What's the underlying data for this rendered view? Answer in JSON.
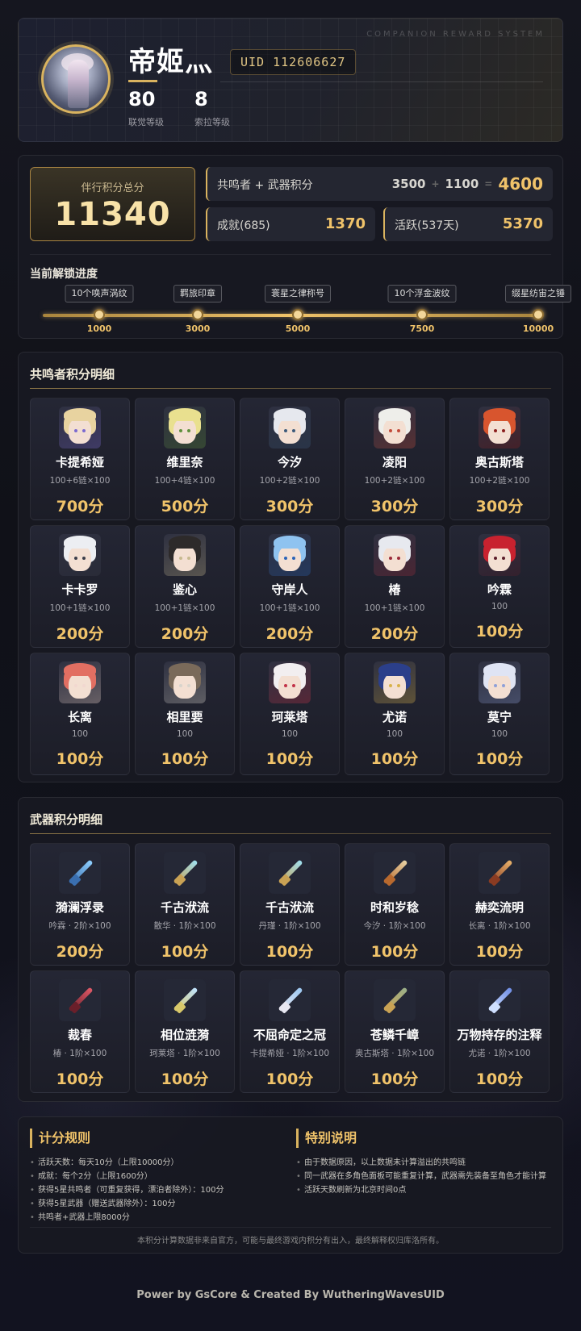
{
  "header": {
    "system_label": "COMPANION REWARD SYSTEM",
    "player_name": "帝姬灬",
    "uid": "UID 112606627",
    "stats": [
      {
        "value": "80",
        "label": "联觉等级"
      },
      {
        "value": "8",
        "label": "索拉等级"
      }
    ]
  },
  "summary": {
    "total_label": "伴行积分总分",
    "total_value": "11340",
    "resonator_weapon_label": "共鸣者 + 武器积分",
    "resonator_points": "3500",
    "plus": "+",
    "weapon_points": "1100",
    "equals": "=",
    "resonator_weapon_total": "4600",
    "achievement_label": "成就(685)",
    "achievement_points": "1370",
    "activity_label": "活跃(537天)",
    "activity_points": "5370"
  },
  "progress": {
    "title": "当前解锁进度",
    "progress_value": 10000,
    "max": 10000,
    "milestones": [
      {
        "value": "1000",
        "reward": "10个唤声涡纹"
      },
      {
        "value": "3000",
        "reward": "羁旅印章"
      },
      {
        "value": "5000",
        "reward": "寰星之律称号"
      },
      {
        "value": "7500",
        "reward": "10个浮金波纹"
      },
      {
        "value": "10000",
        "reward": "缀星纺宙之锤"
      }
    ]
  },
  "resonators": {
    "title": "共鸣者积分明细",
    "items": [
      {
        "name": "卡提希娅",
        "detail": "100+6链×100",
        "score": "700分",
        "hair": "#e8d3a0",
        "accent": "#7b6ad0"
      },
      {
        "name": "维里奈",
        "detail": "100+4链×100",
        "score": "500分",
        "hair": "#e9e08f",
        "accent": "#5e8f3b"
      },
      {
        "name": "今汐",
        "detail": "100+2链×100",
        "score": "300分",
        "hair": "#e6e8ee",
        "accent": "#3c5a7a"
      },
      {
        "name": "凌阳",
        "detail": "100+2链×100",
        "score": "300分",
        "hair": "#eeeeea",
        "accent": "#c24a3a"
      },
      {
        "name": "奥古斯塔",
        "detail": "100+2链×100",
        "score": "300分",
        "hair": "#d8552e",
        "accent": "#8b1e1e"
      },
      {
        "name": "卡卡罗",
        "detail": "100+1链×100",
        "score": "200分",
        "hair": "#eceef2",
        "accent": "#3a3d4a"
      },
      {
        "name": "鉴心",
        "detail": "100+1链×100",
        "score": "200分",
        "hair": "#2d2a2a",
        "accent": "#c7b98f"
      },
      {
        "name": "守岸人",
        "detail": "100+1链×100",
        "score": "200分",
        "hair": "#8fc3f0",
        "accent": "#2a63b7"
      },
      {
        "name": "椿",
        "detail": "100+1链×100",
        "score": "200分",
        "hair": "#e7e9ef",
        "accent": "#9b2b3a"
      },
      {
        "name": "吟霖",
        "detail": "100",
        "score": "100分",
        "hair": "#c8222f",
        "accent": "#5a1d2a"
      },
      {
        "name": "长离",
        "detail": "100",
        "score": "100分",
        "hair": "#e26f62",
        "accent": "#f2d8d0"
      },
      {
        "name": "相里要",
        "detail": "100",
        "score": "100分",
        "hair": "#7a6a5a",
        "accent": "#d8d4cc"
      },
      {
        "name": "珂莱塔",
        "detail": "100",
        "score": "100分",
        "hair": "#f2eef0",
        "accent": "#c23248"
      },
      {
        "name": "尤诺",
        "detail": "100",
        "score": "100分",
        "hair": "#2b3f8a",
        "accent": "#d8b24a"
      },
      {
        "name": "莫宁",
        "detail": "100",
        "score": "100分",
        "hair": "#dfe4f4",
        "accent": "#8ea0d8"
      }
    ]
  },
  "weapons": {
    "title": "武器积分明细",
    "items": [
      {
        "name": "漪澜浮录",
        "detail": "吟霖 · 2阶×100",
        "score": "200分",
        "blade": "#8fd0ff",
        "hilt": "#3a6fb0"
      },
      {
        "name": "千古洑流",
        "detail": "散华 · 1阶×100",
        "score": "100分",
        "blade": "#9fe0f0",
        "hilt": "#c9a254"
      },
      {
        "name": "千古洑流",
        "detail": "丹瑾 · 1阶×100",
        "score": "100分",
        "blade": "#9fe0f0",
        "hilt": "#c9a254"
      },
      {
        "name": "时和岁稔",
        "detail": "今汐 · 1阶×100",
        "score": "100分",
        "blade": "#e7d2a4",
        "hilt": "#b8692e"
      },
      {
        "name": "赫奕流明",
        "detail": "长离 · 1阶×100",
        "score": "100分",
        "blade": "#e9b36c",
        "hilt": "#8a3b22"
      },
      {
        "name": "裁春",
        "detail": "椿 · 1阶×100",
        "score": "100分",
        "blade": "#e05a68",
        "hilt": "#6a1f2a"
      },
      {
        "name": "相位涟漪",
        "detail": "珂莱塔 · 1阶×100",
        "score": "100分",
        "blade": "#bfe3ff",
        "hilt": "#d8c86a"
      },
      {
        "name": "不屈命定之冠",
        "detail": "卡提希娅 · 1阶×100",
        "score": "100分",
        "blade": "#9cc8f2",
        "hilt": "#e8e8f2"
      },
      {
        "name": "苍鳞千嶂",
        "detail": "奥古斯塔 · 1阶×100",
        "score": "100分",
        "blade": "#9ab08a",
        "hilt": "#c9a254"
      },
      {
        "name": "万物持存的注释",
        "detail": "尤诺 · 1阶×100",
        "score": "100分",
        "blade": "#6f8ee6",
        "hilt": "#cfe0ff"
      }
    ]
  },
  "rules": {
    "title": "计分规则",
    "items": [
      "活跃天数：每天10分（上限10000分）",
      "成就：每个2分（上限1600分）",
      "获得5星共鸣者（可重复获得，漂泊者除外）：100分",
      "获得5星武器（赠送武器除外）：100分",
      "共鸣者+武器上限8000分"
    ]
  },
  "notes": {
    "title": "特别说明",
    "items": [
      "由于数据原因，以上数据未计算溢出的共鸣链",
      "同一武器在多角色面板可能重复计算，武器需先装备至角色才能计算",
      "活跃天数刷新为北京时间0点"
    ]
  },
  "disclaimer": "本积分计算数据非来自官方，可能与最终游戏内积分有出入，最终解释权归库洛所有。",
  "footer": "Power by GsCore & Created By WutheringWavesUID"
}
